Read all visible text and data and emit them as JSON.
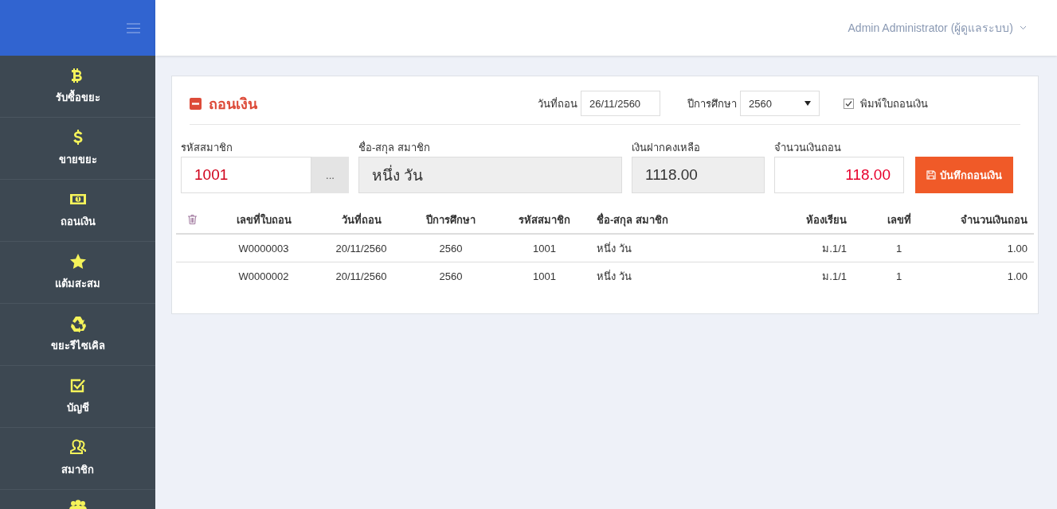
{
  "sidebar": {
    "items": [
      {
        "label": "รับซื้อขยะ"
      },
      {
        "label": "ขายขยะ"
      },
      {
        "label": "ถอนเงิน"
      },
      {
        "label": "แต้มสะสม"
      },
      {
        "label": "ขยะรีไซเคิล"
      },
      {
        "label": "บัญชี"
      },
      {
        "label": "สมาชิก"
      }
    ]
  },
  "header": {
    "user": "Admin Administrator (ผู้ดูแลระบบ)"
  },
  "panel": {
    "title": "ถอนเงิน",
    "date": {
      "label": "วันที่ถอน",
      "value": "26/11/2560"
    },
    "year": {
      "label": "ปีการศึกษา",
      "value": "2560"
    },
    "print_receipt": {
      "label": "พิมพ์ใบถอนเงิน",
      "checked": true
    },
    "fields": [
      {
        "kind": "lookup",
        "label": "รหัสสมาชิก",
        "value": "1001",
        "button": "..."
      },
      {
        "kind": "readonly",
        "label": "ชื่อ-สกุล สมาชิก",
        "value": "หนึ่ง วัน"
      },
      {
        "kind": "readonly",
        "label": "เงินฝากคงเหลือ",
        "value": "1118.00"
      },
      {
        "kind": "amount",
        "label": "จำนวนเงินถอน",
        "value": "118.00"
      }
    ],
    "save_button": "บันทึกถอนเงิน",
    "table": {
      "columns": [
        "เลขที่ใบถอน",
        "วันที่ถอน",
        "ปีการศึกษา",
        "รหัสสมาชิก",
        "ชื่อ-สกุล สมาชิก",
        "ห้องเรียน",
        "เลขที่",
        "จำนวนเงินถอน"
      ],
      "rows": [
        [
          "W0000003",
          "20/11/2560",
          "2560",
          "1001",
          "หนึ่ง วัน",
          "ม.1/1",
          "1",
          "1.00"
        ],
        [
          "W0000002",
          "20/11/2560",
          "2560",
          "1001",
          "หนึ่ง วัน",
          "ม.1/1",
          "1",
          "1.00"
        ]
      ]
    }
  }
}
